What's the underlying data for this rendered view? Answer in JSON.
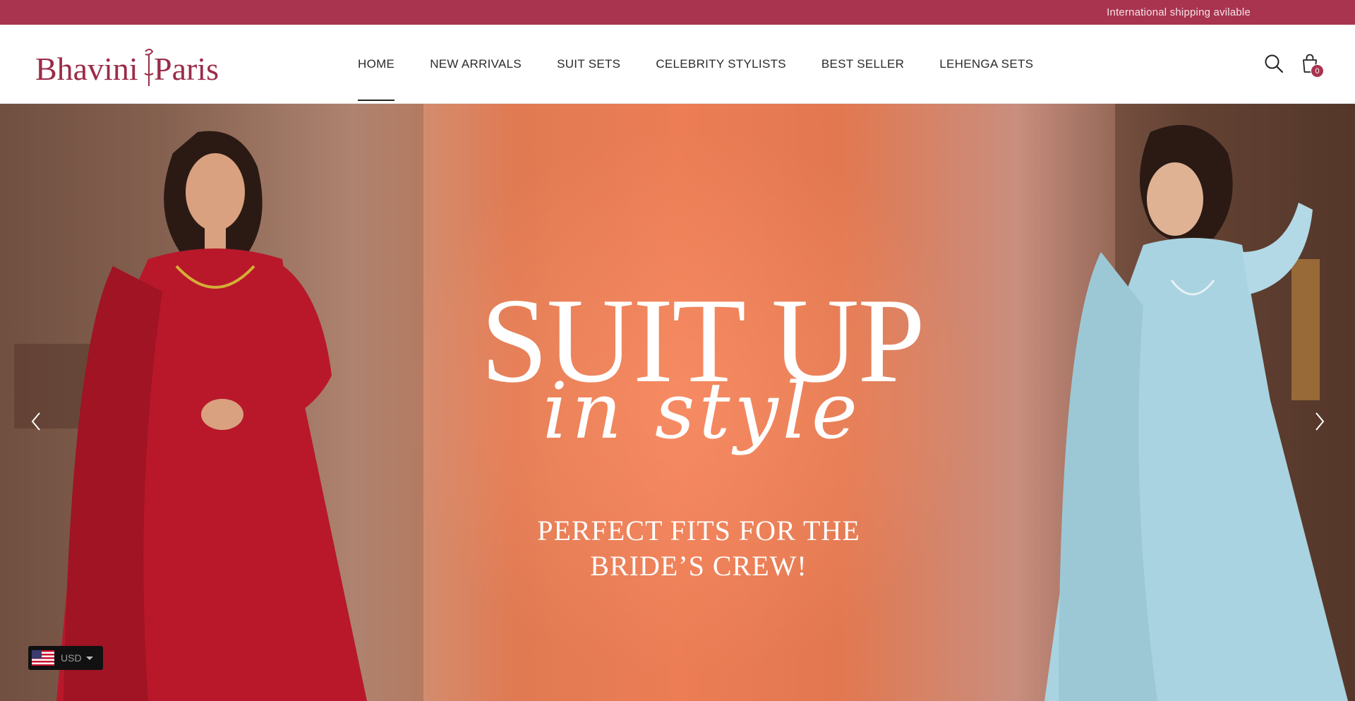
{
  "announcement": {
    "text": "International shipping avilable"
  },
  "brand": {
    "logo_text": "BHAVINI PARIS",
    "color": "#9b2c48"
  },
  "nav": {
    "items": [
      {
        "label": "HOME",
        "active": true
      },
      {
        "label": "NEW ARRIVALS",
        "active": false
      },
      {
        "label": "SUIT SETS",
        "active": false
      },
      {
        "label": "CELEBRITY STYLISTS",
        "active": false
      },
      {
        "label": "BEST SELLER",
        "active": false
      },
      {
        "label": "LEHENGA SETS",
        "active": false
      }
    ]
  },
  "header_icons": {
    "search": "search-icon",
    "cart": "shopping-bag-icon",
    "cart_count": "0"
  },
  "hero": {
    "title": "SUIT UP",
    "script": "in style",
    "tagline_line1": "PERFECT FITS FOR THE",
    "tagline_line2": "BRIDE’S CREW!",
    "arrows": {
      "prev": "chevron-left-icon",
      "next": "chevron-right-icon"
    }
  },
  "currency": {
    "code": "USD",
    "flag": "us-flag-icon"
  },
  "colors": {
    "accent": "#a8344f",
    "hero_bg": "#ec7d55",
    "red_dress": "#b8182a",
    "blue_dress": "#a9d3e0"
  }
}
